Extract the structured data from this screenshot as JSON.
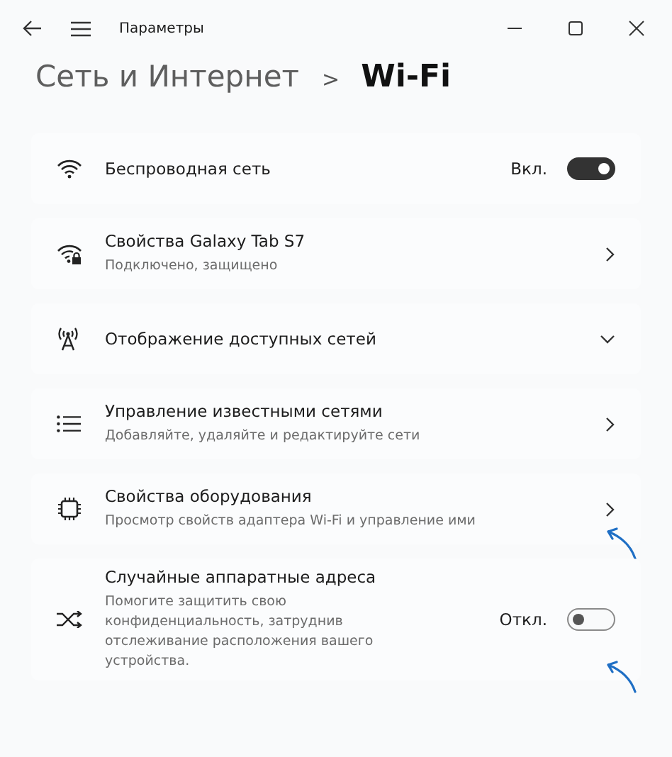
{
  "window": {
    "title": "Параметры"
  },
  "breadcrumb": {
    "parent": "Сеть и Интернет",
    "separator": ">",
    "current": "Wi-Fi"
  },
  "settings": [
    {
      "kind": "toggle",
      "title": "Беспроводная сеть",
      "state_label": "Вкл.",
      "on": true,
      "annotated": false
    },
    {
      "kind": "link",
      "title": "Свойства Galaxy Tab S7",
      "subtitle": "Подключено, защищено",
      "annotated": false
    },
    {
      "kind": "expand",
      "title": "Отображение доступных сетей",
      "expanded": false,
      "annotated": false
    },
    {
      "kind": "link",
      "title": "Управление известными сетями",
      "subtitle": "Добавляйте, удаляйте и редактируйте сети",
      "annotated": false
    },
    {
      "kind": "link",
      "title": "Свойства оборудования",
      "subtitle": "Просмотр свойств адаптера Wi-Fi и управление ими",
      "annotated": true
    },
    {
      "kind": "toggle",
      "title": "Случайные аппаратные адреса",
      "subtitle": "Помогите защитить свою конфиденциальность, затруднив отслеживание расположения вашего устройства.",
      "state_label": "Откл.",
      "on": false,
      "annotated": true
    }
  ]
}
